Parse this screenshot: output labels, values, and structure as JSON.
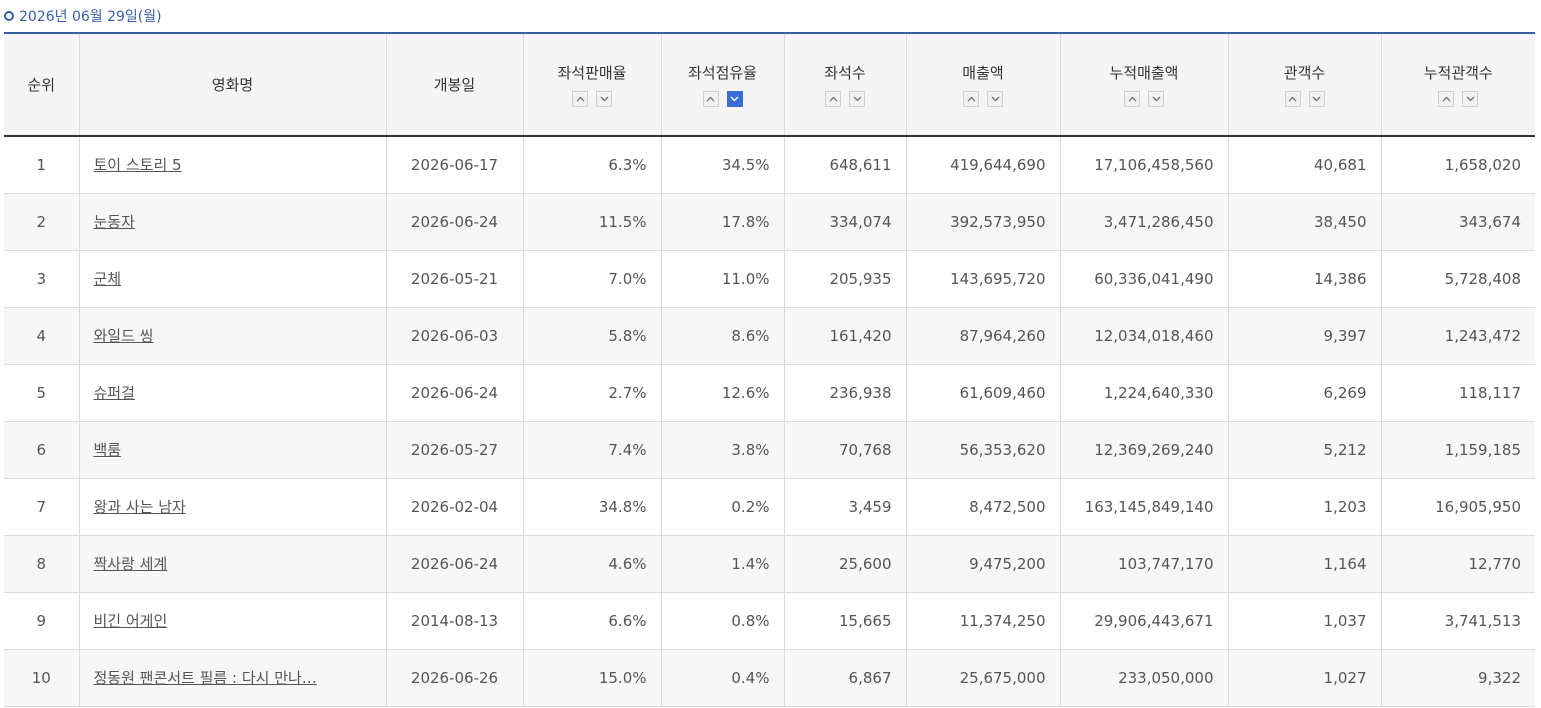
{
  "date_label": "2026년 06월 29일(월)",
  "columns": [
    {
      "key": "rank",
      "label": "순위",
      "sortable": false
    },
    {
      "key": "title",
      "label": "영화명",
      "sortable": false
    },
    {
      "key": "release",
      "label": "개봉일",
      "sortable": false
    },
    {
      "key": "seat_sales_rate",
      "label": "좌석판매율",
      "sortable": true,
      "active": null
    },
    {
      "key": "seat_share",
      "label": "좌석점유율",
      "sortable": true,
      "active": "desc"
    },
    {
      "key": "seats",
      "label": "좌석수",
      "sortable": true,
      "active": null
    },
    {
      "key": "sales",
      "label": "매출액",
      "sortable": true,
      "active": null
    },
    {
      "key": "cum_sales",
      "label": "누적매출액",
      "sortable": true,
      "active": null
    },
    {
      "key": "audience",
      "label": "관객수",
      "sortable": true,
      "active": null
    },
    {
      "key": "cum_audience",
      "label": "누적관객수",
      "sortable": true,
      "active": null
    }
  ],
  "rows": [
    {
      "rank": "1",
      "title": "토이 스토리 5",
      "release": "2026-06-17",
      "seat_sales_rate": "6.3%",
      "seat_share": "34.5%",
      "seats": "648,611",
      "sales": "419,644,690",
      "cum_sales": "17,106,458,560",
      "audience": "40,681",
      "cum_audience": "1,658,020"
    },
    {
      "rank": "2",
      "title": "눈동자",
      "release": "2026-06-24",
      "seat_sales_rate": "11.5%",
      "seat_share": "17.8%",
      "seats": "334,074",
      "sales": "392,573,950",
      "cum_sales": "3,471,286,450",
      "audience": "38,450",
      "cum_audience": "343,674"
    },
    {
      "rank": "3",
      "title": "군체",
      "release": "2026-05-21",
      "seat_sales_rate": "7.0%",
      "seat_share": "11.0%",
      "seats": "205,935",
      "sales": "143,695,720",
      "cum_sales": "60,336,041,490",
      "audience": "14,386",
      "cum_audience": "5,728,408"
    },
    {
      "rank": "4",
      "title": "와일드 씽",
      "release": "2026-06-03",
      "seat_sales_rate": "5.8%",
      "seat_share": "8.6%",
      "seats": "161,420",
      "sales": "87,964,260",
      "cum_sales": "12,034,018,460",
      "audience": "9,397",
      "cum_audience": "1,243,472"
    },
    {
      "rank": "5",
      "title": "슈퍼걸",
      "release": "2026-06-24",
      "seat_sales_rate": "2.7%",
      "seat_share": "12.6%",
      "seats": "236,938",
      "sales": "61,609,460",
      "cum_sales": "1,224,640,330",
      "audience": "6,269",
      "cum_audience": "118,117"
    },
    {
      "rank": "6",
      "title": "백룸",
      "release": "2026-05-27",
      "seat_sales_rate": "7.4%",
      "seat_share": "3.8%",
      "seats": "70,768",
      "sales": "56,353,620",
      "cum_sales": "12,369,269,240",
      "audience": "5,212",
      "cum_audience": "1,159,185"
    },
    {
      "rank": "7",
      "title": "왕과 사는 남자",
      "release": "2026-02-04",
      "seat_sales_rate": "34.8%",
      "seat_share": "0.2%",
      "seats": "3,459",
      "sales": "8,472,500",
      "cum_sales": "163,145,849,140",
      "audience": "1,203",
      "cum_audience": "16,905,950"
    },
    {
      "rank": "8",
      "title": "짝사랑 세계",
      "release": "2026-06-24",
      "seat_sales_rate": "4.6%",
      "seat_share": "1.4%",
      "seats": "25,600",
      "sales": "9,475,200",
      "cum_sales": "103,747,170",
      "audience": "1,164",
      "cum_audience": "12,770"
    },
    {
      "rank": "9",
      "title": "비긴 어게인",
      "release": "2014-08-13",
      "seat_sales_rate": "6.6%",
      "seat_share": "0.8%",
      "seats": "15,665",
      "sales": "11,374,250",
      "cum_sales": "29,906,443,671",
      "audience": "1,037",
      "cum_audience": "3,741,513"
    },
    {
      "rank": "10",
      "title": "정동원 팬콘서트 필름 : 다시 만나…",
      "release": "2026-06-26",
      "seat_sales_rate": "15.0%",
      "seat_share": "0.4%",
      "seats": "6,867",
      "sales": "25,675,000",
      "cum_sales": "233,050,000",
      "audience": "1,027",
      "cum_audience": "9,322"
    }
  ],
  "icons": {
    "bullet": "circle-bullet-icon",
    "sort_up": "chevron-up-icon",
    "sort_down": "chevron-down-icon"
  },
  "colors": {
    "accent": "#3a5ea8",
    "active_sort": "#3a6ed6",
    "header_bg": "#f5f5f5",
    "row_alt": "#f7f7f7"
  }
}
